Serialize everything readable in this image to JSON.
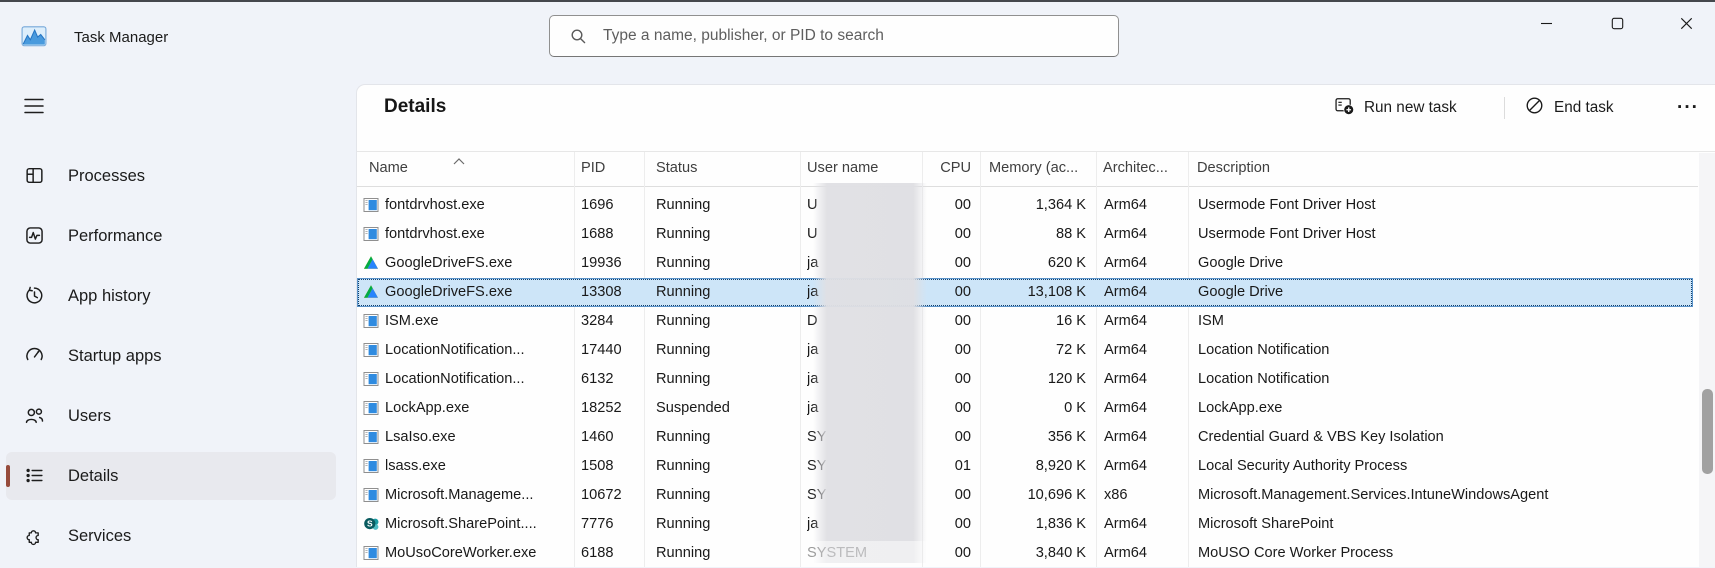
{
  "titlebar": {
    "title": "Task Manager"
  },
  "search": {
    "placeholder": "Type a name, publisher, or PID to search"
  },
  "sidebar": {
    "items": [
      {
        "label": "Processes",
        "icon": "processes",
        "selected": false
      },
      {
        "label": "Performance",
        "icon": "performance",
        "selected": false
      },
      {
        "label": "App history",
        "icon": "app-history",
        "selected": false
      },
      {
        "label": "Startup apps",
        "icon": "startup-apps",
        "selected": false
      },
      {
        "label": "Users",
        "icon": "users",
        "selected": false
      },
      {
        "label": "Details",
        "icon": "details",
        "selected": true
      },
      {
        "label": "Services",
        "icon": "services",
        "selected": false
      }
    ]
  },
  "main": {
    "title": "Details",
    "toolbar": {
      "run_new_task": "Run new task",
      "end_task": "End task",
      "more": "···"
    },
    "table": {
      "columns": [
        "Name",
        "PID",
        "Status",
        "User name",
        "CPU",
        "Memory (ac...",
        "Architec...",
        "Description"
      ],
      "sort": {
        "column": "Name",
        "direction": "ascending"
      },
      "rows": [
        {
          "icon": "exe",
          "name": "fontdrvhost.exe",
          "pid": "1696",
          "status": "Running",
          "user": "U",
          "cpu": "00",
          "memory": "1,364 K",
          "arch": "Arm64",
          "description": "Usermode Font Driver Host",
          "selected": false
        },
        {
          "icon": "exe",
          "name": "fontdrvhost.exe",
          "pid": "1688",
          "status": "Running",
          "user": "U",
          "cpu": "00",
          "memory": "88 K",
          "arch": "Arm64",
          "description": "Usermode Font Driver Host",
          "selected": false
        },
        {
          "icon": "gdrive",
          "name": "GoogleDriveFS.exe",
          "pid": "19936",
          "status": "Running",
          "user": "ja",
          "cpu": "00",
          "memory": "620 K",
          "arch": "Arm64",
          "description": "Google Drive",
          "selected": false
        },
        {
          "icon": "gdrive",
          "name": "GoogleDriveFS.exe",
          "pid": "13308",
          "status": "Running",
          "user": "ja",
          "cpu": "00",
          "memory": "13,108 K",
          "arch": "Arm64",
          "description": "Google Drive",
          "selected": true
        },
        {
          "icon": "exe",
          "name": "ISM.exe",
          "pid": "3284",
          "status": "Running",
          "user": "D",
          "cpu": "00",
          "memory": "16 K",
          "arch": "Arm64",
          "description": "ISM",
          "selected": false
        },
        {
          "icon": "exe",
          "name": "LocationNotification...",
          "pid": "17440",
          "status": "Running",
          "user": "ja",
          "cpu": "00",
          "memory": "72 K",
          "arch": "Arm64",
          "description": "Location Notification",
          "selected": false
        },
        {
          "icon": "exe",
          "name": "LocationNotification...",
          "pid": "6132",
          "status": "Running",
          "user": "ja",
          "cpu": "00",
          "memory": "120 K",
          "arch": "Arm64",
          "description": "Location Notification",
          "selected": false
        },
        {
          "icon": "exe",
          "name": "LockApp.exe",
          "pid": "18252",
          "status": "Suspended",
          "user": "ja",
          "cpu": "00",
          "memory": "0 K",
          "arch": "Arm64",
          "description": "LockApp.exe",
          "selected": false
        },
        {
          "icon": "exe",
          "name": "LsaIso.exe",
          "pid": "1460",
          "status": "Running",
          "user": "SY",
          "cpu": "00",
          "memory": "356 K",
          "arch": "Arm64",
          "description": "Credential Guard & VBS Key Isolation",
          "selected": false
        },
        {
          "icon": "exe",
          "name": "lsass.exe",
          "pid": "1508",
          "status": "Running",
          "user": "SY",
          "cpu": "01",
          "memory": "8,920 K",
          "arch": "Arm64",
          "description": "Local Security Authority Process",
          "selected": false
        },
        {
          "icon": "exe",
          "name": "Microsoft.Manageme...",
          "pid": "10672",
          "status": "Running",
          "user": "SY",
          "cpu": "00",
          "memory": "10,696 K",
          "arch": "x86",
          "description": "Microsoft.Management.Services.IntuneWindowsAgent",
          "selected": false
        },
        {
          "icon": "sharepoint",
          "name": "Microsoft.SharePoint....",
          "pid": "7776",
          "status": "Running",
          "user": "ja",
          "cpu": "00",
          "memory": "1,836 K",
          "arch": "Arm64",
          "description": "Microsoft SharePoint",
          "selected": false
        },
        {
          "icon": "exe",
          "name": "MoUsoCoreWorker.exe",
          "pid": "6188",
          "status": "Running",
          "user": "SYSTEM",
          "user_dim": true,
          "cpu": "00",
          "memory": "3,840 K",
          "arch": "Arm64",
          "description": "MoUSO Core Worker Process",
          "selected": false
        }
      ]
    }
  },
  "colors": {
    "accent": "#964b3c",
    "selection_background": "#cde5f8",
    "selection_border": "#2d6da8",
    "window_background": "#f0f3f9"
  }
}
